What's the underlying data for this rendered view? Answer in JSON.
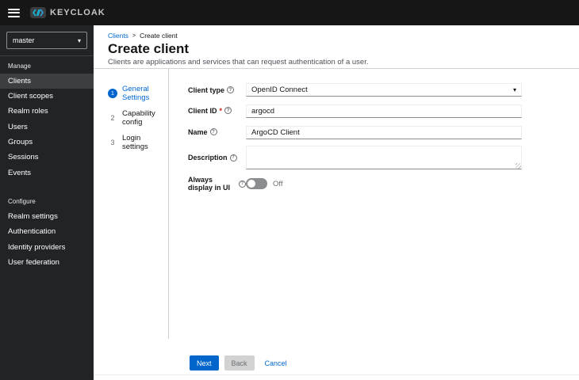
{
  "header": {
    "logo_text": "KEYCLOAK"
  },
  "icons": {
    "caret_down": "▾",
    "breadcrumb_separator": ">",
    "help": "?"
  },
  "sidebar": {
    "realm_selector": {
      "value": "master"
    },
    "groups": [
      {
        "label": "Manage",
        "items": [
          {
            "label": "Clients",
            "active": true
          },
          {
            "label": "Client scopes",
            "active": false
          },
          {
            "label": "Realm roles",
            "active": false
          },
          {
            "label": "Users",
            "active": false
          },
          {
            "label": "Groups",
            "active": false
          },
          {
            "label": "Sessions",
            "active": false
          },
          {
            "label": "Events",
            "active": false
          }
        ]
      },
      {
        "label": "Configure",
        "items": [
          {
            "label": "Realm settings",
            "active": false
          },
          {
            "label": "Authentication",
            "active": false
          },
          {
            "label": "Identity providers",
            "active": false
          },
          {
            "label": "User federation",
            "active": false
          }
        ]
      }
    ]
  },
  "breadcrumb": {
    "items": [
      "Clients",
      "Create client"
    ]
  },
  "page": {
    "title": "Create client",
    "subtitle": "Clients are applications and services that can request authentication of a user."
  },
  "wizard": {
    "steps": [
      {
        "number": "1",
        "label": "General Settings",
        "active": true
      },
      {
        "number": "2",
        "label": "Capability config",
        "active": false
      },
      {
        "number": "3",
        "label": "Login settings",
        "active": false
      }
    ]
  },
  "form": {
    "fields": [
      {
        "label": "Client type",
        "type": "select",
        "value": "OpenID Connect",
        "required_marker": ""
      },
      {
        "label": "Client ID",
        "type": "text",
        "value": "argocd",
        "required_marker": "*"
      },
      {
        "label": "Name",
        "type": "text",
        "value": "ArgoCD Client",
        "required_marker": ""
      },
      {
        "label": "Description",
        "type": "textarea",
        "value": "",
        "required_marker": ""
      },
      {
        "label": "Always display in UI",
        "type": "toggle",
        "value": "Off",
        "required_marker": ""
      }
    ]
  },
  "footer": {
    "next_label": "Next",
    "back_label": "Back",
    "cancel_label": "Cancel"
  },
  "colors": {
    "accent": "#0066cc",
    "header_bg": "#161616",
    "sidebar_bg": "#212427",
    "selected_item_bg": "#3c3f42",
    "danger": "#c9190b"
  }
}
